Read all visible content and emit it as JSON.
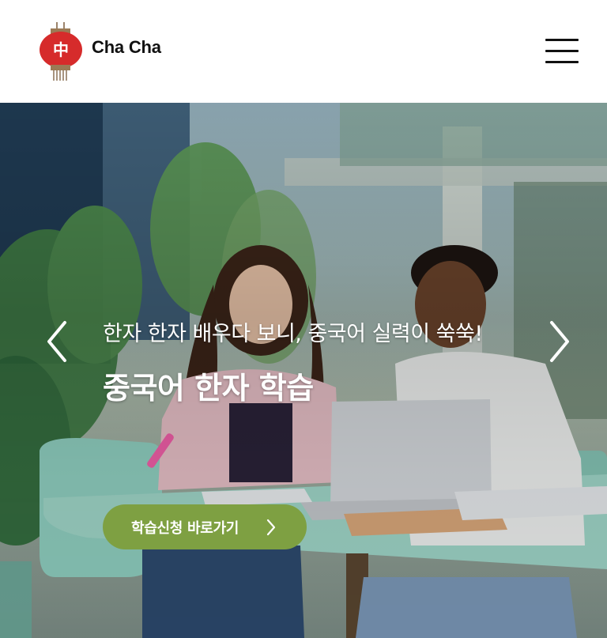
{
  "header": {
    "logo_text": "Cha Cha",
    "logo_icon": "lantern-icon",
    "logo_icon_glyph": "中",
    "menu_icon": "hamburger-menu-icon"
  },
  "hero": {
    "subtitle": "한자 한자 배우다 보니, 중국어 실력이 쑥쑥!",
    "title": "중국어 한자 학습",
    "cta_label": "학습신청 바로가기",
    "prev_icon": "chevron-left-icon",
    "next_icon": "chevron-right-icon"
  },
  "colors": {
    "brand_red": "#d62b2b",
    "cta_green": "#7ea042",
    "text_dark": "#111111"
  }
}
